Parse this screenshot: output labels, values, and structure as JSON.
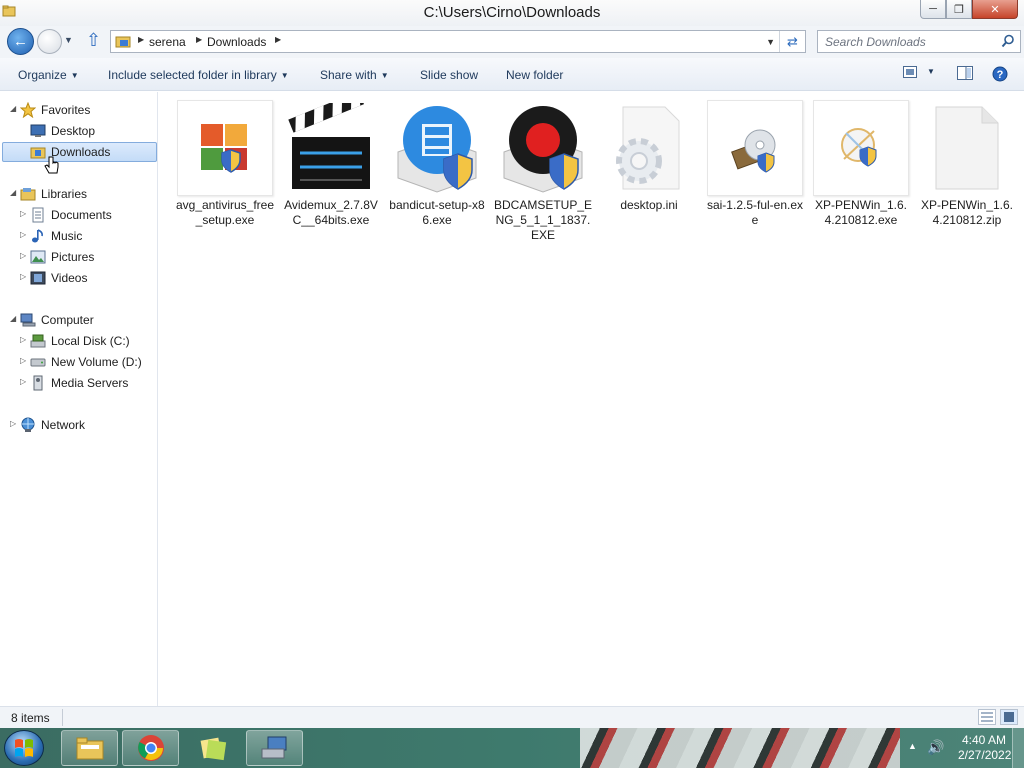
{
  "window": {
    "title": "C:\\Users\\Cirno\\Downloads",
    "controls": {
      "minimize": "─",
      "maximize": "❐",
      "close": "✕"
    }
  },
  "address_bar": {
    "crumbs": [
      "serena",
      "Downloads"
    ]
  },
  "search": {
    "placeholder": "Search Downloads"
  },
  "command_bar": {
    "organize": "Organize",
    "include_library": "Include selected folder in library",
    "share_with": "Share with",
    "slide_show": "Slide show",
    "new_folder": "New folder"
  },
  "nav_pane": {
    "favorites": {
      "label": "Favorites",
      "items": [
        "Desktop",
        "Downloads"
      ]
    },
    "libraries": {
      "label": "Libraries",
      "items": [
        "Documents",
        "Music",
        "Pictures",
        "Videos"
      ]
    },
    "computer": {
      "label": "Computer",
      "items": [
        "Local Disk (C:)",
        "New Volume (D:)",
        "Media Servers"
      ]
    },
    "network": {
      "label": "Network"
    },
    "selected": "Downloads"
  },
  "files": [
    {
      "name": "avg_antivirus_free_setup.exe",
      "icon": "avg-installer-icon"
    },
    {
      "name": "Avidemux_2.7.8VC__64bits.exe",
      "icon": "clapperboard-icon"
    },
    {
      "name": "bandicut-setup-x86.exe",
      "icon": "bandicut-installer-icon"
    },
    {
      "name": "BDCAMSETUP_ENG_5_1_1_1837.EXE",
      "icon": "bandicam-installer-icon"
    },
    {
      "name": "desktop.ini",
      "icon": "settings-file-icon"
    },
    {
      "name": "sai-1.2.5-ful-en.exe",
      "icon": "setup-disc-icon"
    },
    {
      "name": "XP-PENWin_1.6.4.210812.exe",
      "icon": "xppen-installer-icon"
    },
    {
      "name": "XP-PENWin_1.6.4.210812.zip",
      "icon": "blank-file-icon"
    }
  ],
  "status_bar": {
    "count": "8 items"
  },
  "taskbar": {
    "clock_time": "4:40 AM",
    "clock_date": "2/27/2022",
    "pinned": [
      "file-explorer",
      "chrome",
      "sticky-notes",
      "remote-desktop"
    ]
  },
  "colors": {
    "accent": "#2b6db3",
    "command_text": "#1e395b",
    "selection_bg": "#c4dcf7",
    "taskbar": "#3e7a6d"
  }
}
